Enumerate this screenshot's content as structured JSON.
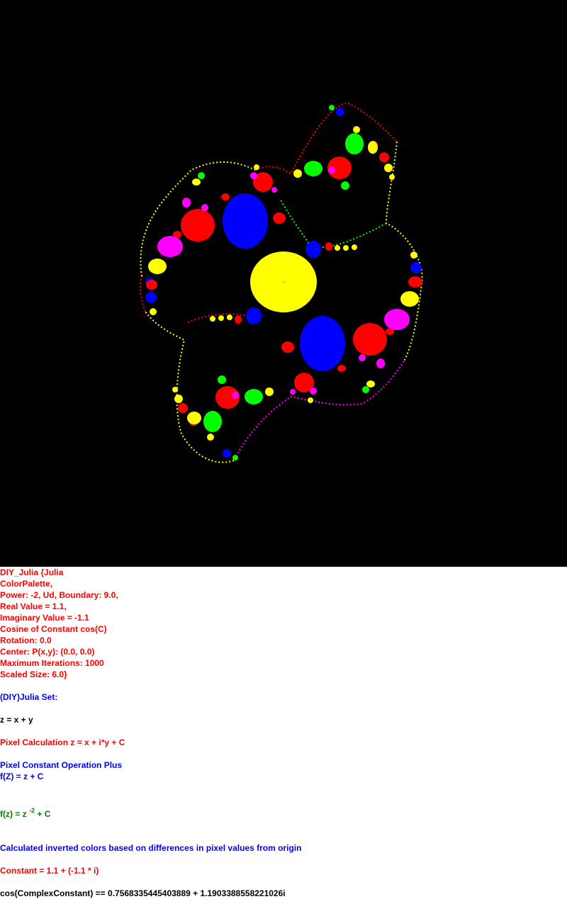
{
  "colors": {
    "background": "#000000",
    "panel": "#ffffff",
    "red_text": "#ff0000",
    "blue_text": "#0000ff",
    "green_text": "#008000",
    "fractal_palette": [
      "#ffff00",
      "#0000ff",
      "#ff0000",
      "#ff00ff",
      "#00ff00"
    ]
  },
  "params": {
    "title": "DIY_Julia {Julia",
    "palette": "ColorPalette,",
    "power": "Power: -2, Ud, Boundary: 9.0,",
    "real": "Real Value = 1.1,",
    "imag": "Imaginary Value = -1.1",
    "cosine": "Cosine of Constant cos(C)",
    "rotation": "Rotation: 0.0",
    "center": "Center: P(x,y): (0.0, 0.0)",
    "max_iter": "Maximum Iterations: 1000",
    "scaled": "Scaled Size: 6.0}"
  },
  "formulas": {
    "set_name": "(DIY)Julia Set:",
    "z_def": "z = x + y",
    "pixel_calc": "Pixel Calculation z = x + i*y + C",
    "const_op": "Pixel Constant Operation Plus",
    "fz": "f(Z) = z + C",
    "fz_prefix": "f(z) = z ",
    "fz_exp": "-2",
    "fz_suffix": " + C",
    "color_method": "Calculated inverted colors based on differences in pixel values from origin",
    "constant": "Constant = 1.1 + (-1.1 * i)",
    "cos_const": "cos(ComplexConstant) == 0.7568335445403889 + 1.1903388558221026i"
  }
}
